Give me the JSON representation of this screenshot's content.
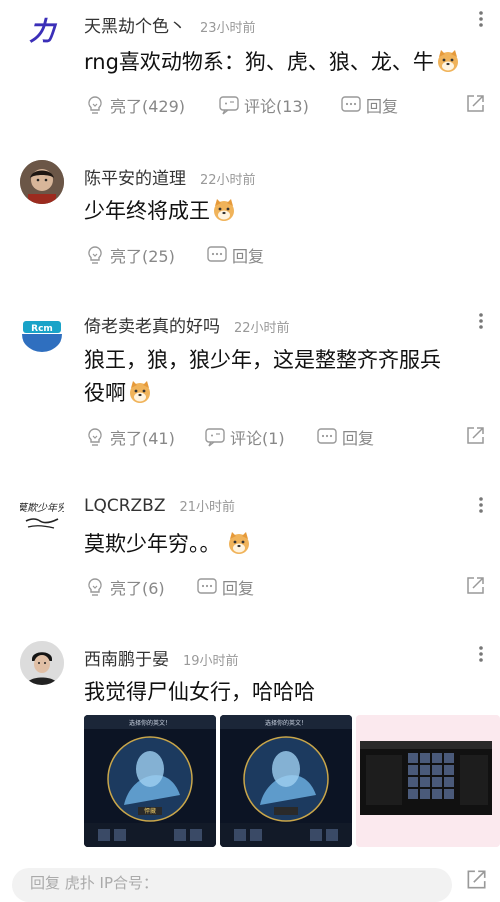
{
  "comments": [
    {
      "username": "天黑劫个色丶",
      "time": "23小时前",
      "text": "rng喜欢动物系：狗、虎、狼、龙、牛",
      "likes": "亮了(429)",
      "comments": "评论(13)",
      "reply": "回复",
      "avatar_text": "力"
    },
    {
      "username": "陈平安的道理",
      "time": "22小时前",
      "text": "少年终将成王",
      "likes": "亮了(25)",
      "reply": "回复"
    },
    {
      "username": "倚老卖老真的好吗",
      "time": "22小时前",
      "text_line1": "狼王，狼，狼少年，这是整整齐齐服兵",
      "text_line2": "役啊",
      "likes": "亮了(41)",
      "comments": "评论(1)",
      "reply": "回复"
    },
    {
      "username": "LQCRZBZ",
      "time": "21小时前",
      "text": "莫欺少年穷。。",
      "likes": "亮了(6)",
      "reply": "回复",
      "avatar_text": "莫欺少年穷"
    },
    {
      "username": "西南鹏于晏",
      "time": "19小时前",
      "text": "我觉得尸仙女行，哈哈哈"
    }
  ],
  "image_texts": [
    "选择你的英文！",
    "选择你的英文！",
    "悍藏"
  ],
  "reply_bar": {
    "placeholder": "回复 虎扑 IP合号："
  },
  "icons": [
    "like-icon",
    "comment-icon",
    "reply-icon",
    "share-icon",
    "more-icon",
    "doge-emoji"
  ]
}
